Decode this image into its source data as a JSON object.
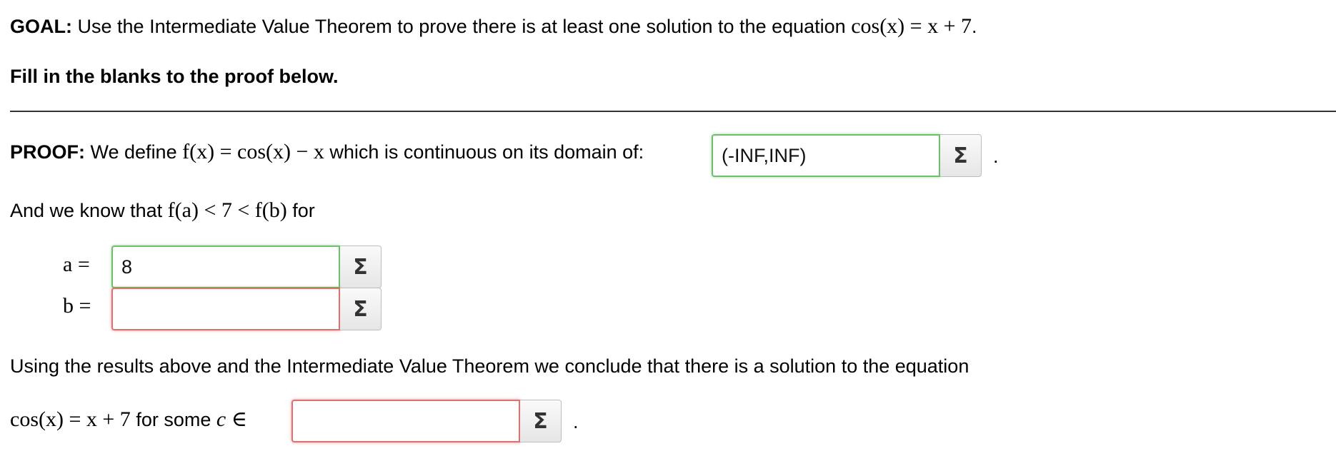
{
  "goal": {
    "label": "GOAL:",
    "text": "Use the Intermediate Value Theorem to prove there is at least one solution to the equation",
    "equation": "cos(x) = x + 7",
    "end": "."
  },
  "instruction": "Fill in the blanks to the proof below.",
  "proof": {
    "label": "PROOF:",
    "text1": "We define",
    "function": "f(x) = cos(x) − x",
    "text2": "which is continuous on its domain of:",
    "domain_value": "(-INF,INF)",
    "end": "."
  },
  "know": {
    "text1": "And we know that",
    "inequality": "f(a) < 7 < f(b)",
    "text2": "for"
  },
  "a_field": {
    "label": "a =",
    "value": "8"
  },
  "b_field": {
    "label": "b =",
    "value": ""
  },
  "conclusion": "Using the results above and the Intermediate Value Theorem we conclude that there is a solution to the equation",
  "final": {
    "equation": "cos(x) = x + 7",
    "text": "for some",
    "var": "c ∈",
    "value": "",
    "end": "."
  },
  "sigma_symbol": "Σ",
  "colors": {
    "correct": "#6cbf6c",
    "incorrect": "#e07070"
  }
}
